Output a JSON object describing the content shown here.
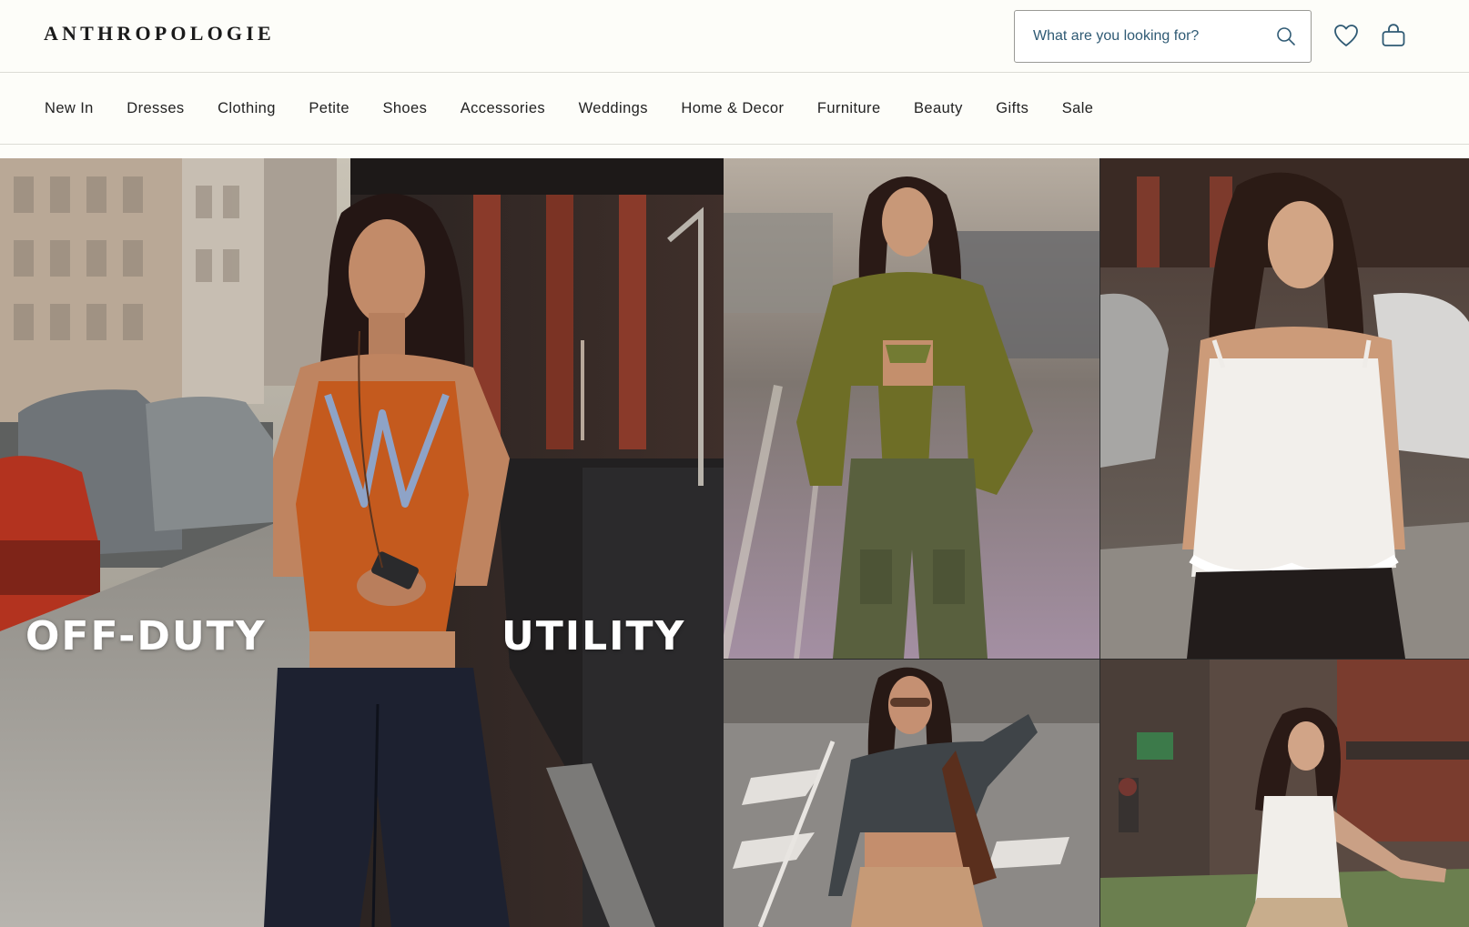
{
  "header": {
    "logo": "ANTHROPOLOGIE",
    "search": {
      "placeholder": "What are you looking for?",
      "value": ""
    },
    "icons": [
      "search-icon",
      "heart-icon",
      "shopping-bag-icon"
    ]
  },
  "nav": {
    "items": [
      {
        "label": "New In"
      },
      {
        "label": "Dresses"
      },
      {
        "label": "Clothing"
      },
      {
        "label": "Petite"
      },
      {
        "label": "Shoes"
      },
      {
        "label": "Accessories"
      },
      {
        "label": "Weddings"
      },
      {
        "label": "Home & Decor"
      },
      {
        "label": "Furniture"
      },
      {
        "label": "Beauty"
      },
      {
        "label": "Gifts"
      },
      {
        "label": "Sale"
      }
    ]
  },
  "hero": {
    "headline_left": "OFF-DUTY",
    "headline_right": "UTILITY"
  },
  "colors": {
    "accent": "#2f5a74",
    "background": "#fdfdf9",
    "border": "#dcdcd6"
  }
}
